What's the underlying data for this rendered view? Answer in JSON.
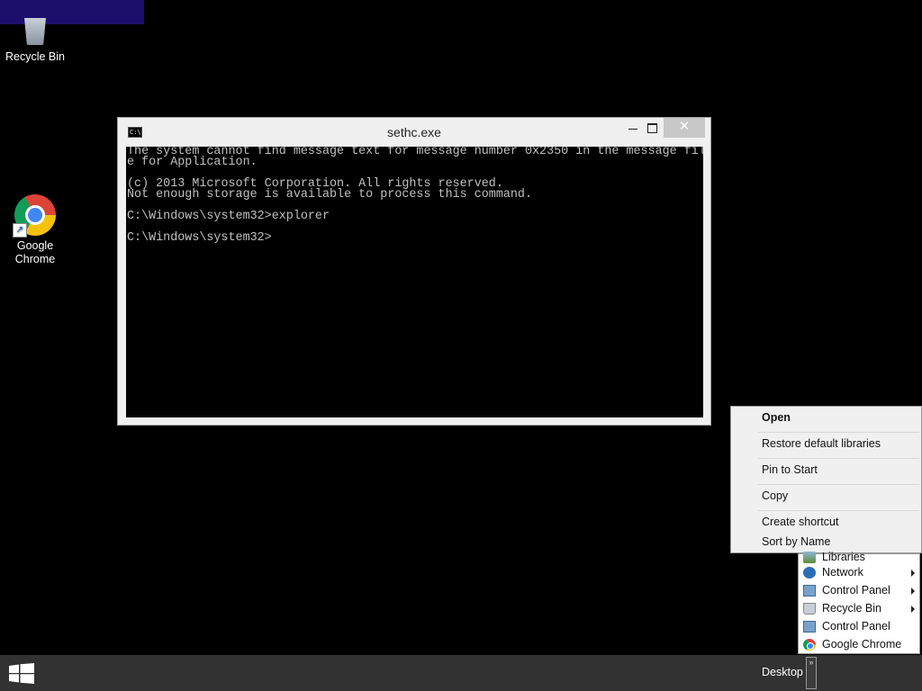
{
  "desktop": {
    "icons": [
      {
        "label": "Recycle Bin",
        "icon": "recycle-bin-icon"
      },
      {
        "label_line1": "Google",
        "label_line2": "Chrome",
        "icon": "chrome-icon"
      }
    ]
  },
  "console": {
    "title": "sethc.exe",
    "close_glyph": "✕",
    "icon_text": "C:\\",
    "lines": [
      "The system cannot find message text for message number 0x2350 in the message fil",
      "e for Application.",
      "",
      "(c) 2013 Microsoft Corporation. All rights reserved.",
      "Not enough storage is available to process this command.",
      "",
      "C:\\Windows\\system32>explorer",
      "",
      "C:\\Windows\\system32>"
    ]
  },
  "context_menu": {
    "items": [
      {
        "label": "Open",
        "bold": true
      },
      {
        "label": "Restore default libraries"
      },
      {
        "label": "Pin to Start"
      },
      {
        "label": "Copy"
      },
      {
        "label": "Create shortcut"
      },
      {
        "label": "Sort by Name"
      }
    ]
  },
  "jump_menu": {
    "items": [
      {
        "label": "Libraries",
        "icon": "libraries-icon",
        "submenu": false
      },
      {
        "label": "Network",
        "icon": "network-icon",
        "submenu": true
      },
      {
        "label": "Control Panel",
        "icon": "control-panel-icon",
        "submenu": true
      },
      {
        "label": "Recycle Bin",
        "icon": "recycle-bin-icon",
        "submenu": true
      },
      {
        "label": "Control Panel",
        "icon": "control-panel-icon",
        "submenu": false
      },
      {
        "label": "Google Chrome",
        "icon": "chrome-icon",
        "submenu": false
      }
    ]
  },
  "taskbar": {
    "toolbar_label": "Desktop",
    "chevron": "»"
  },
  "colors": {
    "desktop_background": "#000000",
    "taskbar": "#323232",
    "top_bar": "#1c0f6b"
  }
}
